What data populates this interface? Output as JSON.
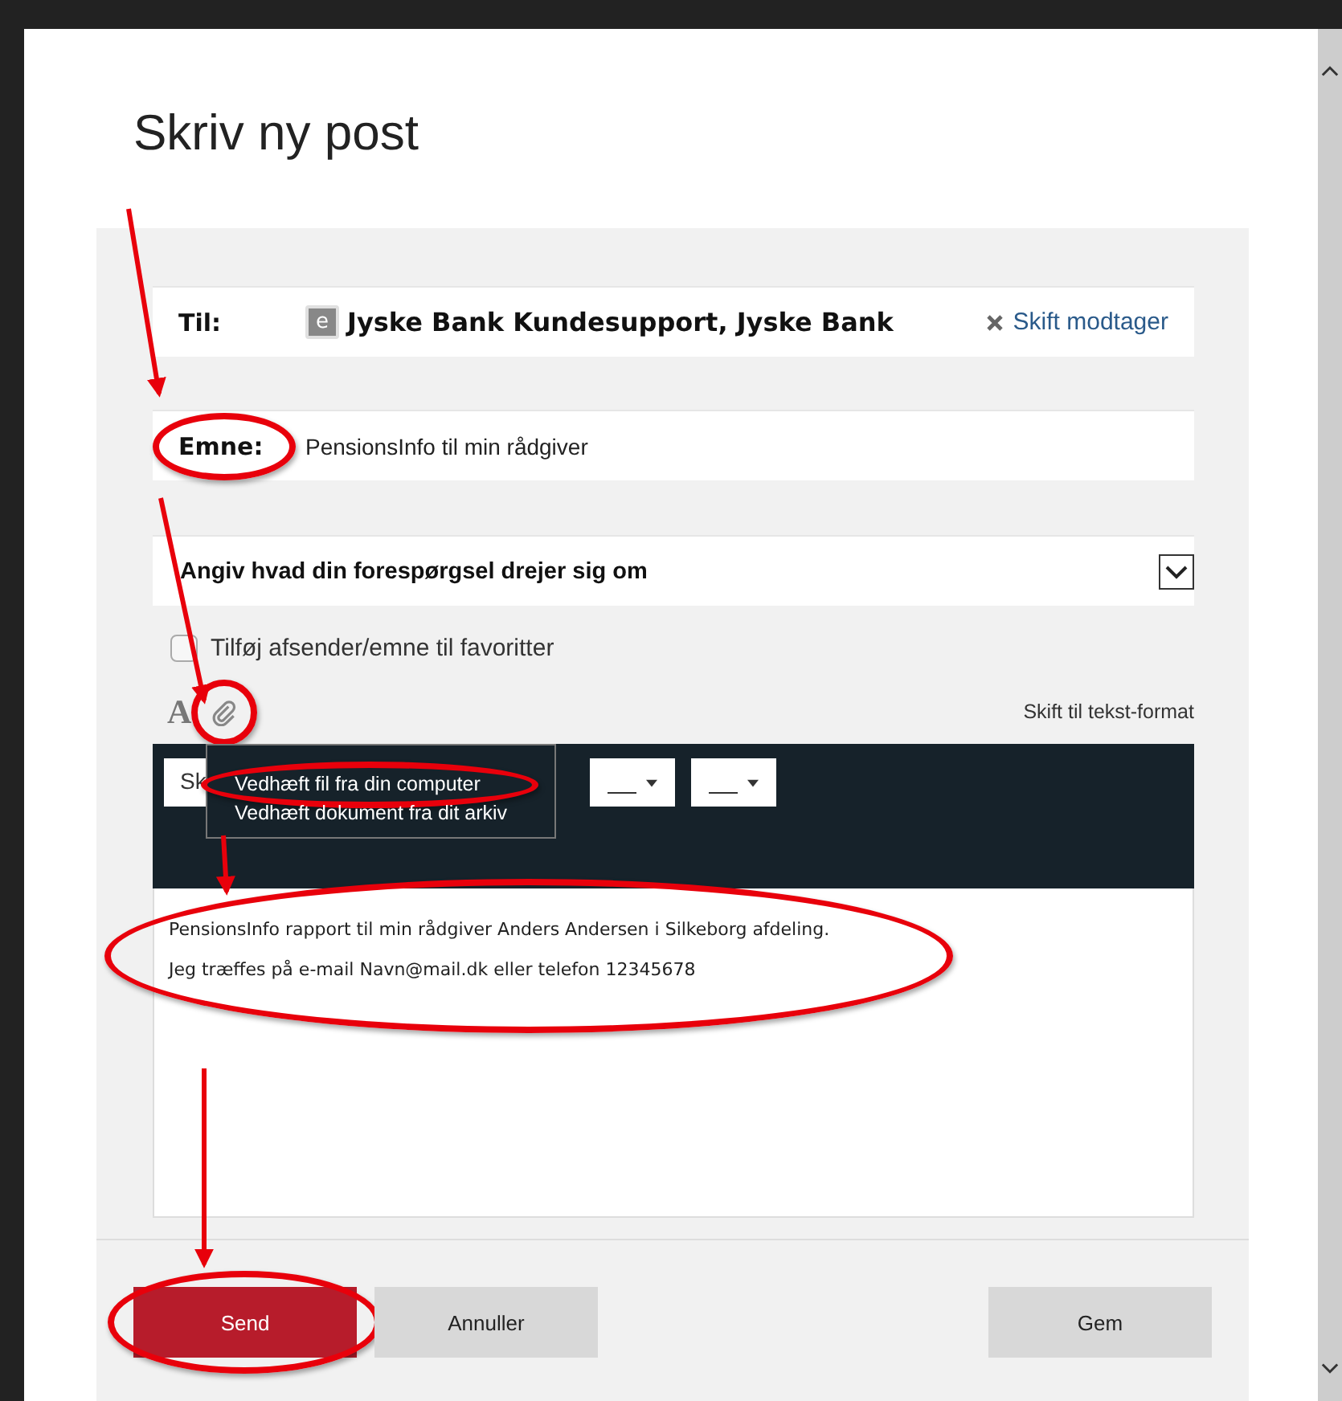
{
  "dialog": {
    "title": "Skriv ny post"
  },
  "recipient": {
    "label": "Til:",
    "badge": "e",
    "name": "Jyske Bank Kundesupport, Jyske Bank",
    "change_link": "Skift modtager"
  },
  "subject": {
    "label": "Emne:",
    "value": "PensionsInfo til min rådgiver",
    "highlighted": true
  },
  "topic_select": {
    "value": "Angiv hvad din forespørgsel drejer sig om"
  },
  "favorite_checkbox": {
    "label": "Tilføj afsender/emne til favoritter",
    "checked": false
  },
  "editor_tools": {
    "format_icon": "A",
    "attach_highlighted": true,
    "text_format_link": "Skift til tekst-format"
  },
  "font_field": {
    "value": "Sk"
  },
  "attach_menu": [
    {
      "label": "Vedhæft fil fra din computer",
      "highlighted": true
    },
    {
      "label": "Vedhæft dokument fra dit arkiv",
      "highlighted": false
    }
  ],
  "body": {
    "lines": [
      "PensionsInfo rapport til min rådgiver Anders Andersen i Silkeborg afdeling.",
      "Jeg træffes på e-mail Navn@mail.dk eller telefon 12345678"
    ],
    "highlighted": true
  },
  "buttons": [
    {
      "label": "Send",
      "kind": "primary",
      "highlighted": true
    },
    {
      "label": "Annuller",
      "kind": "secondary",
      "highlighted": false
    },
    {
      "label": "Gem",
      "kind": "secondary",
      "highlighted": false
    }
  ]
}
